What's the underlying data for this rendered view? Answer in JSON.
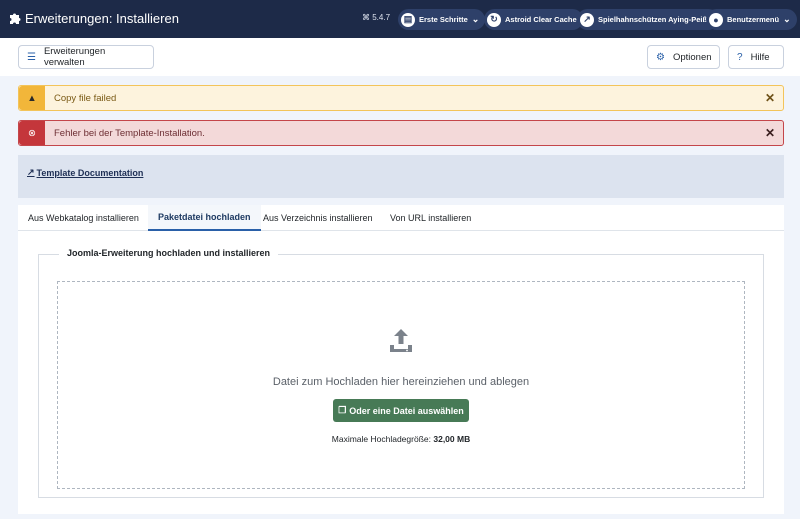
{
  "header": {
    "title": "Erweiterungen: Installieren",
    "version": "⌘ 5.4.7",
    "pills": [
      {
        "label": "Erste Schritte",
        "icon": "signpost-icon"
      },
      {
        "label": "Astroid Clear Cache",
        "icon": "refresh-icon"
      },
      {
        "label": "Spielhahnschützen Aying-Peiß...",
        "icon": "external-link-icon"
      },
      {
        "label": "Benutzermenü",
        "icon": "user-icon"
      }
    ]
  },
  "toolbar": {
    "manage_label": "Erweiterungen verwalten",
    "options_label": "Optionen",
    "help_label": "Hilfe"
  },
  "alerts": {
    "warning": "Copy file failed",
    "error": "Fehler bei der Template-Installation."
  },
  "doc": {
    "link": "Template Documentation"
  },
  "tabs": [
    {
      "label": "Aus Webkatalog installieren"
    },
    {
      "label": "Paketdatei hochladen"
    },
    {
      "label": "Aus Verzeichnis installieren"
    },
    {
      "label": "Von URL installieren"
    }
  ],
  "upload": {
    "legend": "Joomla-Erweiterung hochladen und installieren",
    "drop_text": "Datei zum Hochladen hier hereinziehen und ablegen",
    "select_button": "Oder eine Datei auswählen",
    "max_label": "Maximale Hochladegröße:",
    "max_value": "32,00 MB"
  },
  "colors": {
    "header_bg": "#1d2a48",
    "warning": "#f2b63a",
    "error": "#c4363b",
    "success_button": "#477a56",
    "accent": "#2a60a8"
  }
}
